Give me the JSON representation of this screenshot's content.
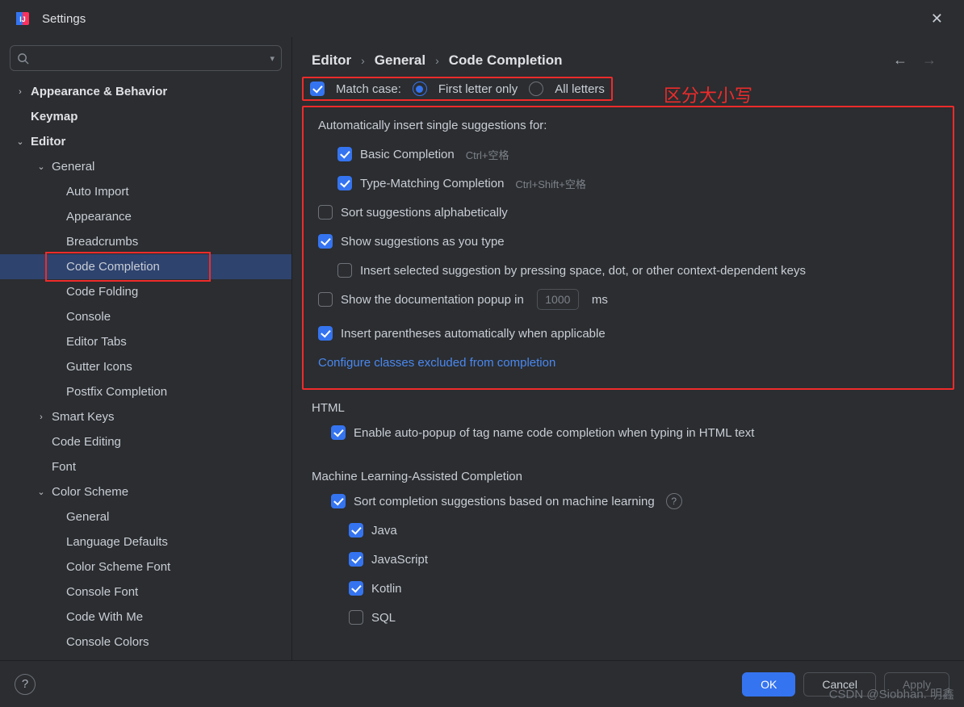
{
  "titlebar": {
    "title": "Settings"
  },
  "search": {
    "placeholder": ""
  },
  "annotation": {
    "match_case_note": "区分大小写"
  },
  "tree": {
    "appearance_behavior": "Appearance & Behavior",
    "keymap": "Keymap",
    "editor": "Editor",
    "general": "General",
    "auto_import": "Auto Import",
    "appearance": "Appearance",
    "breadcrumbs": "Breadcrumbs",
    "code_completion": "Code Completion",
    "code_folding": "Code Folding",
    "console": "Console",
    "editor_tabs": "Editor Tabs",
    "gutter_icons": "Gutter Icons",
    "postfix_completion": "Postfix Completion",
    "smart_keys": "Smart Keys",
    "code_editing": "Code Editing",
    "font": "Font",
    "color_scheme": "Color Scheme",
    "cs_general": "General",
    "cs_language_defaults": "Language Defaults",
    "cs_color_scheme_font": "Color Scheme Font",
    "cs_console_font": "Console Font",
    "cs_code_with_me": "Code With Me",
    "cs_console_colors": "Console Colors"
  },
  "breadcrumb": {
    "a": "Editor",
    "b": "General",
    "c": "Code Completion"
  },
  "opts": {
    "match_case": "Match case:",
    "first_letter_only": "First letter only",
    "all_letters": "All letters",
    "auto_insert": "Automatically insert single suggestions for:",
    "basic_completion": "Basic Completion",
    "basic_hint": "Ctrl+空格",
    "type_matching": "Type-Matching Completion",
    "type_hint": "Ctrl+Shift+空格",
    "sort_alpha": "Sort suggestions alphabetically",
    "show_as_type": "Show suggestions as you type",
    "insert_by_keys": "Insert selected suggestion by pressing space, dot, or other context-dependent keys",
    "show_doc_popup": "Show the documentation popup in",
    "doc_delay": "1000",
    "ms": "ms",
    "insert_paren": "Insert parentheses automatically when applicable",
    "configure_link": "Configure classes excluded from completion",
    "html_section": "HTML",
    "html_enable": "Enable auto-popup of tag name code completion when typing in HTML text",
    "ml_section": "Machine Learning-Assisted Completion",
    "ml_sort": "Sort completion suggestions based on machine learning",
    "ml_java": "Java",
    "ml_js": "JavaScript",
    "ml_kotlin": "Kotlin",
    "ml_sql": "SQL"
  },
  "footer": {
    "ok": "OK",
    "cancel": "Cancel",
    "apply": "Apply"
  },
  "watermark": "CSDN @Siobhan. 明鑫"
}
